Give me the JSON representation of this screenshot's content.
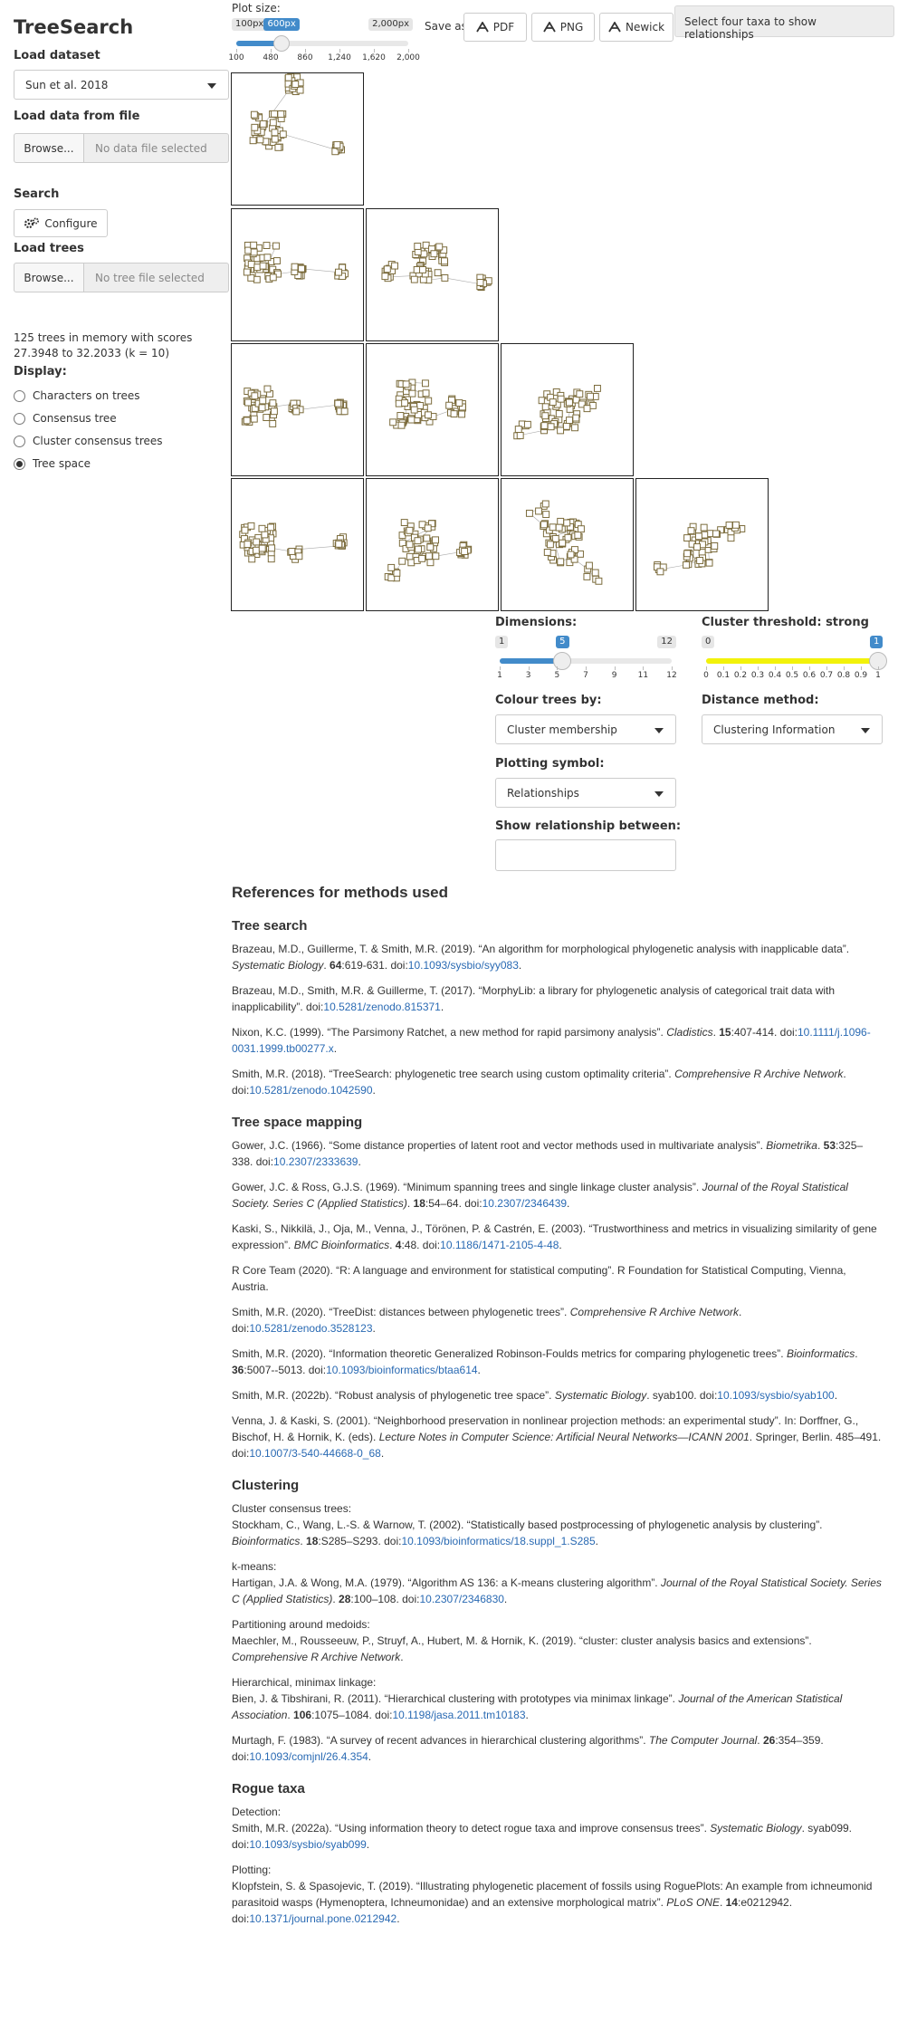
{
  "app": {
    "title": "TreeSearch"
  },
  "sidebar": {
    "load_dataset_label": "Load dataset",
    "dataset_value": "Sun et al. 2018",
    "load_file_label": "Load data from file",
    "browse_label": "Browse...",
    "data_file_placeholder": "No data file selected",
    "search_label": "Search",
    "configure_label": "Configure",
    "load_trees_label": "Load trees",
    "tree_file_placeholder": "No tree file selected",
    "status_line1": "125 trees in memory with scores",
    "status_line2": "27.3948 to 32.2033 (k = 10)",
    "display_label": "Display:",
    "display_options": [
      {
        "label": "Characters on trees",
        "selected": false
      },
      {
        "label": "Consensus tree",
        "selected": false
      },
      {
        "label": "Cluster consensus trees",
        "selected": false
      },
      {
        "label": "Tree space",
        "selected": true
      }
    ]
  },
  "top": {
    "plot_size_label": "Plot size:",
    "plot_size_min": "100px",
    "plot_size_value": "600px",
    "plot_size_max": "2,000px",
    "plot_size_fraction": 0.263,
    "plot_size_ticks": [
      "100",
      "480",
      "860",
      "1,240",
      "1,620",
      "2,000"
    ],
    "save_as_label": "Save as:",
    "save_buttons": [
      "PDF",
      "PNG",
      "Newick"
    ],
    "tooltip": "Select four taxa to show relationships"
  },
  "controls": {
    "dimensions_label": "Dimensions:",
    "dimensions_min": "1",
    "dimensions_value": "5",
    "dimensions_max": "12",
    "dimensions_fraction": 0.364,
    "dimensions_ticks": [
      "1",
      "3",
      "5",
      "7",
      "9",
      "11",
      "12"
    ],
    "threshold_label": "Cluster threshold: strong",
    "threshold_min": "0",
    "threshold_value": "1",
    "threshold_fraction": 1.0,
    "threshold_ticks": [
      "0",
      "0.1",
      "0.2",
      "0.3",
      "0.4",
      "0.5",
      "0.6",
      "0.7",
      "0.8",
      "0.9",
      "1"
    ],
    "colour_label": "Colour trees by:",
    "colour_value": "Cluster membership",
    "distance_label": "Distance method:",
    "distance_value": "Clustering Information",
    "symbol_label": "Plotting symbol:",
    "symbol_value": "Relationships",
    "relationship_label": "Show relationship between:",
    "relationship_value": ""
  },
  "colors": {
    "accent": "#428bca",
    "point": "#7a6a3a",
    "threshold": "#f2f20a"
  },
  "references": {
    "title": "References for methods used",
    "tree_search": {
      "heading": "Tree search",
      "r1_text": "Brazeau, M.D., Guillerme, T. & Smith, M.R. (2019). “An algorithm for morphological phylogenetic analysis with inapplicable data”.",
      "r1_journal": "Systematic Biology",
      "r1_vol": "64",
      "r1_pages": ":619-631. doi:",
      "r1_doi": "10.1093/sysbio/syy083",
      "r2_text": "Brazeau, M.D., Smith, M.R. & Guillerme, T. (2017). “MorphyLib: a library for phylogenetic analysis of categorical trait data with inapplicability”. doi:",
      "r2_doi": "10.5281/zenodo.815371",
      "r3_text": "Nixon, K.C. (1999). “The Parsimony Ratchet, a new method for rapid parsimony analysis”.",
      "r3_journal": "Cladistics",
      "r3_vol": "15",
      "r3_pages": ":407-414. doi:",
      "r3_doi": "10.1111/j.1096-0031.1999.tb00277.x",
      "r4_text": "Smith, M.R. (2018). “TreeSearch: phylogenetic tree search using custom optimality criteria”.",
      "r4_journal": "Comprehensive R Archive Network",
      "r4_pages": ". doi:",
      "r4_doi": "10.5281/zenodo.1042590"
    },
    "tree_space": {
      "heading": "Tree space mapping",
      "r1_text": "Gower, J.C. (1966). “Some distance properties of latent root and vector methods used in multivariate analysis”.",
      "r1_journal": "Biometrika",
      "r1_vol": "53",
      "r1_pages": ":325–338. doi:",
      "r1_doi": "10.2307/2333639",
      "r2_text": "Gower, J.C. & Ross, G.J.S. (1969). “Minimum spanning trees and single linkage cluster analysis”.",
      "r2_journal": "Journal of the Royal Statistical Society. Series C (Applied Statistics)",
      "r2_vol": "18",
      "r2_pages": ":54–64. doi:",
      "r2_doi": "10.2307/2346439",
      "r3_text": "Kaski, S., Nikkilä, J., Oja, M., Venna, J., Törönen, P. & Castrén, E. (2003). “Trustworthiness and metrics in visualizing similarity of gene expression”.",
      "r3_journal": "BMC Bioinformatics",
      "r3_vol": "4",
      "r3_pages": ":48. doi:",
      "r3_doi": "10.1186/1471-2105-4-48",
      "r4_text": "R Core Team (2020). “R: A language and environment for statistical computing”. R Foundation for Statistical Computing, Vienna, Austria.",
      "r5_text": "Smith, M.R. (2020). “TreeDist: distances between phylogenetic trees”.",
      "r5_journal": "Comprehensive R Archive Network",
      "r5_pages": ". doi:",
      "r5_doi": "10.5281/zenodo.3528123",
      "r6_text": "Smith, M.R. (2020). “Information theoretic Generalized Robinson-Foulds metrics for comparing phylogenetic trees”.",
      "r6_journal": "Bioinformatics",
      "r6_vol": "36",
      "r6_pages": ":5007--5013. doi:",
      "r6_doi": "10.1093/bioinformatics/btaa614",
      "r7_text": "Smith, M.R. (2022b). “Robust analysis of phylogenetic tree space”.",
      "r7_journal": "Systematic Biology",
      "r7_pages": ". syab100. doi:",
      "r7_doi": "10.1093/sysbio/syab100",
      "r8_text": "Venna, J. & Kaski, S. (2001). “Neighborhood preservation in nonlinear projection methods: an experimental study”. In: Dorffner, G., Bischof, H. & Hornik, K. (eds).",
      "r8_journal": "Lecture Notes in Computer Science: Artificial Neural Networks—ICANN 2001",
      "r8_pages": ". Springer, Berlin. 485–491. doi:",
      "r8_doi": "10.1007/3-540-44668-0_68"
    },
    "clustering": {
      "heading": "Clustering",
      "c1_label": "Cluster consensus trees:",
      "c1_text": "Stockham, C., Wang, L.-S. & Warnow, T. (2002). “Statistically based postprocessing of phylogenetic analysis by clustering”.",
      "c1_journal": "Bioinformatics",
      "c1_vol": "18",
      "c1_pages": ":S285–S293. doi:",
      "c1_doi": "10.1093/bioinformatics/18.suppl_1.S285",
      "c2_label": "k-means:",
      "c2_text": "Hartigan, J.A. & Wong, M.A. (1979). “Algorithm AS 136: a K-means clustering algorithm”.",
      "c2_journal": "Journal of the Royal Statistical Society. Series C (Applied Statistics)",
      "c2_vol": "28",
      "c2_pages": ":100–108. doi:",
      "c2_doi": "10.2307/2346830",
      "c3_label": "Partitioning around medoids:",
      "c3_text": "Maechler, M., Rousseeuw, P., Struyf, A., Hubert, M. & Hornik, K. (2019). “cluster: cluster analysis basics and extensions”.",
      "c3_journal": "Comprehensive R Archive Network",
      "c3_pages": ".",
      "c4_label": "Hierarchical, minimax linkage:",
      "c4_text": "Bien, J. & Tibshirani, R. (2011). “Hierarchical clustering with prototypes via minimax linkage”.",
      "c4_journal": "Journal of the American Statistical Association",
      "c4_vol": "106",
      "c4_pages": ":1075–1084. doi:",
      "c4_doi": "10.1198/jasa.2011.tm10183",
      "c5_text": "Murtagh, F. (1983). “A survey of recent advances in hierarchical clustering algorithms”.",
      "c5_journal": "The Computer Journal",
      "c5_vol": "26",
      "c5_pages": ":354–359. doi:",
      "c5_doi": "10.1093/comjnl/26.4.354"
    },
    "rogue": {
      "heading": "Rogue taxa",
      "g1_label": "Detection:",
      "g1_text": "Smith, M.R. (2022a). “Using information theory to detect rogue taxa and improve consensus trees”.",
      "g1_journal": "Systematic Biology",
      "g1_pages": ". syab099. doi:",
      "g1_doi": "10.1093/sysbio/syab099",
      "g2_label": "Plotting:",
      "g2_text": "Klopfstein, S. & Spasojevic, T. (2019). “Illustrating phylogenetic placement of fossils using RoguePlots: An example from ichneumonid parasitoid wasps (Hymenoptera, Ichneumonidae) and an extensive morphological matrix”.",
      "g2_journal": "PLoS ONE",
      "g2_vol": "14",
      "g2_pages": ":e0212942. doi:",
      "g2_doi": "10.1371/journal.pone.0212942"
    }
  }
}
